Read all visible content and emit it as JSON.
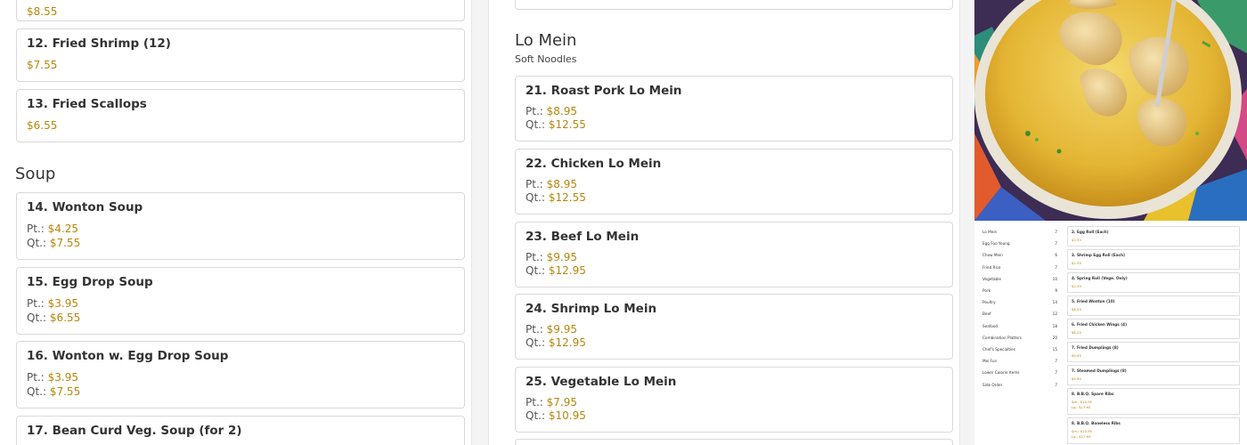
{
  "left": {
    "top_price": "$8.55",
    "appetizer_items": [
      {
        "title": "12. Fried Shrimp (12)",
        "price": "$7.55"
      },
      {
        "title": "13. Fried Scallops",
        "price": "$6.55"
      }
    ],
    "soup_heading": "Soup",
    "soup_items": [
      {
        "title": "14. Wonton Soup",
        "pt": "$4.25",
        "qt": "$7.55"
      },
      {
        "title": "15. Egg Drop Soup",
        "pt": "$3.95",
        "qt": "$6.55"
      },
      {
        "title": "16. Wonton w. Egg Drop Soup",
        "pt": "$3.95",
        "qt": "$7.55"
      },
      {
        "title": "17. Bean Curd Veg. Soup (for 2)"
      }
    ]
  },
  "middle": {
    "section_heading": "Lo Mein",
    "section_subtitle": "Soft Noodles",
    "items": [
      {
        "title": "21. Roast Pork Lo Mein",
        "pt": "$8.95",
        "qt": "$12.55"
      },
      {
        "title": "22. Chicken Lo Mein",
        "pt": "$8.95",
        "qt": "$12.55"
      },
      {
        "title": "23. Beef Lo Mein",
        "pt": "$9.95",
        "qt": "$12.95"
      },
      {
        "title": "24. Shrimp Lo Mein",
        "pt": "$9.95",
        "qt": "$12.95"
      },
      {
        "title": "25. Vegetable Lo Mein",
        "pt": "$7.95",
        "qt": "$10.95"
      }
    ]
  },
  "labels": {
    "pt": "Pt.:",
    "qt": "Qt.:"
  },
  "right": {
    "photo_icon": "wonton-soup-photo",
    "mini_categories": [
      {
        "name": "Lo Mein",
        "count": "7"
      },
      {
        "name": "Egg Foo Young",
        "count": "7"
      },
      {
        "name": "Chow Mein",
        "count": "6"
      },
      {
        "name": "Fried Rice",
        "count": "7"
      },
      {
        "name": "Vegetable",
        "count": "10"
      },
      {
        "name": "Pork",
        "count": "9"
      },
      {
        "name": "Poultry",
        "count": "14"
      },
      {
        "name": "Beef",
        "count": "12"
      },
      {
        "name": "Seafood",
        "count": "18"
      },
      {
        "name": "Combination Platters",
        "count": "20"
      },
      {
        "name": "Chef's Specialties",
        "count": "15"
      },
      {
        "name": "Mei Fun",
        "count": "7"
      },
      {
        "name": "Lower Calorie Items",
        "count": "7"
      },
      {
        "name": "Side Order",
        "count": "7"
      }
    ],
    "mini_items": [
      {
        "title": "2. Egg Roll (Each)",
        "lines": [
          "$2.35"
        ]
      },
      {
        "title": "3. Shrimp Egg Roll (Each)",
        "lines": [
          "$2.35"
        ]
      },
      {
        "title": "4. Spring Roll (Vege. Only)",
        "lines": [
          "$2.35"
        ]
      },
      {
        "title": "5. Fried Wonton (10)",
        "lines": [
          "$6.55"
        ]
      },
      {
        "title": "6. Fried Chicken Wings (4)",
        "lines": [
          "$8.25"
        ]
      },
      {
        "title": "7. Fried Dumplings (8)",
        "lines": [
          "$9.95"
        ]
      },
      {
        "title": "7. Steamed Dumplings (8)",
        "lines": [
          "$9.95"
        ]
      },
      {
        "title": "8. B.B.Q. Spare Ribs",
        "lines": [
          "Sm.: $10.95",
          "Lg.: $17.95"
        ]
      },
      {
        "title": "8. B.B.Q. Boneless Ribs",
        "lines": [
          "Sm.: $10.95",
          "Lg.: $17.95"
        ]
      }
    ]
  },
  "colors": {
    "price": "#b8860b",
    "border": "#d9d9d9",
    "page_bg": "#f4f4f4"
  }
}
